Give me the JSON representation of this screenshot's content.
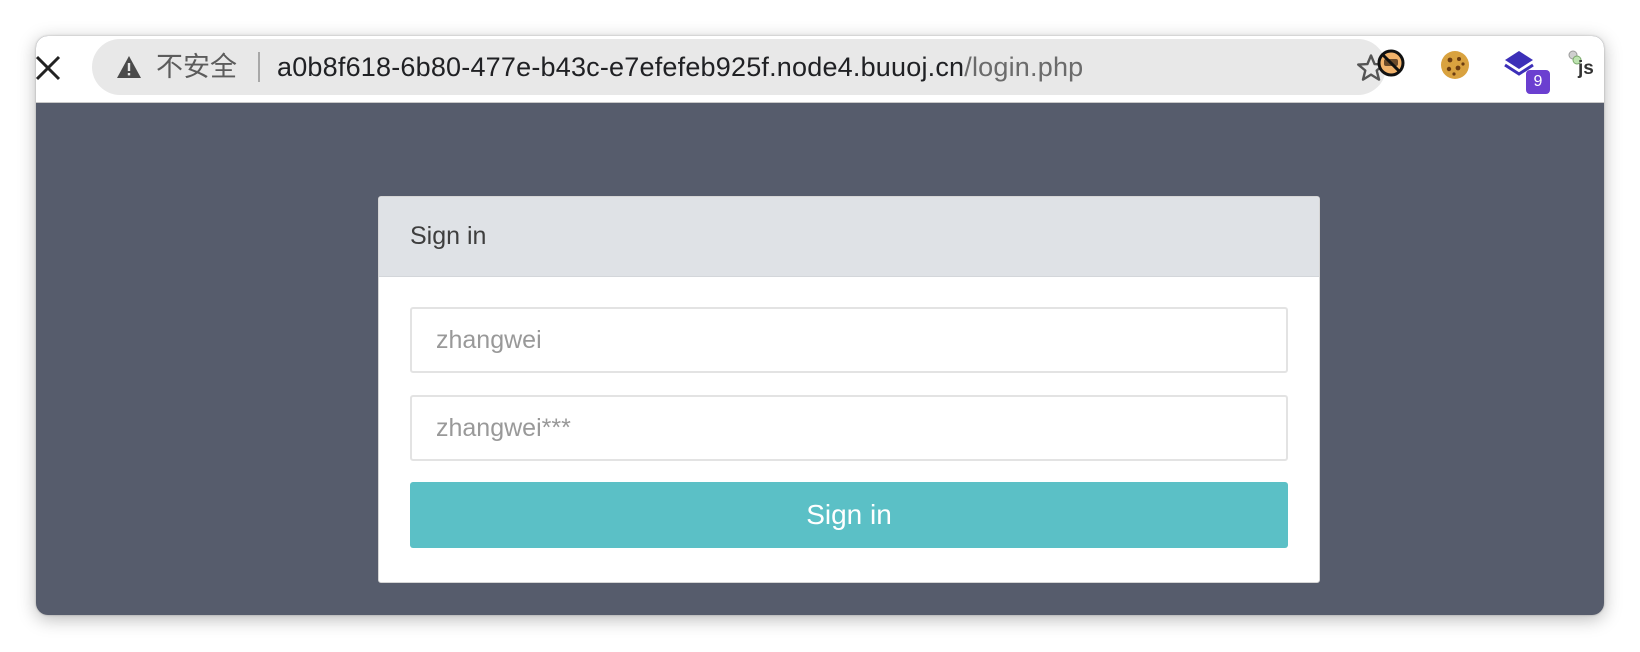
{
  "browser": {
    "security_label": "不安全",
    "url_host": "a0b8f618-6b80-477e-b43c-e7efefeb925f.node4.buuoj.cn",
    "url_path": "/login.php",
    "extensions": [
      {
        "name": "no-tracking-extension-icon"
      },
      {
        "name": "cookie-extension-icon"
      },
      {
        "name": "stacked-layers-extension-icon",
        "badge": "9",
        "badge_color": "#6b3fd0"
      },
      {
        "name": "js-extension-icon",
        "label": "js"
      }
    ]
  },
  "page": {
    "background_color": "#565c6c",
    "login": {
      "title": "Sign in",
      "username_placeholder": "zhangwei",
      "password_placeholder": "zhangwei***",
      "submit_label": "Sign in",
      "button_color": "#5bc0c6"
    }
  }
}
